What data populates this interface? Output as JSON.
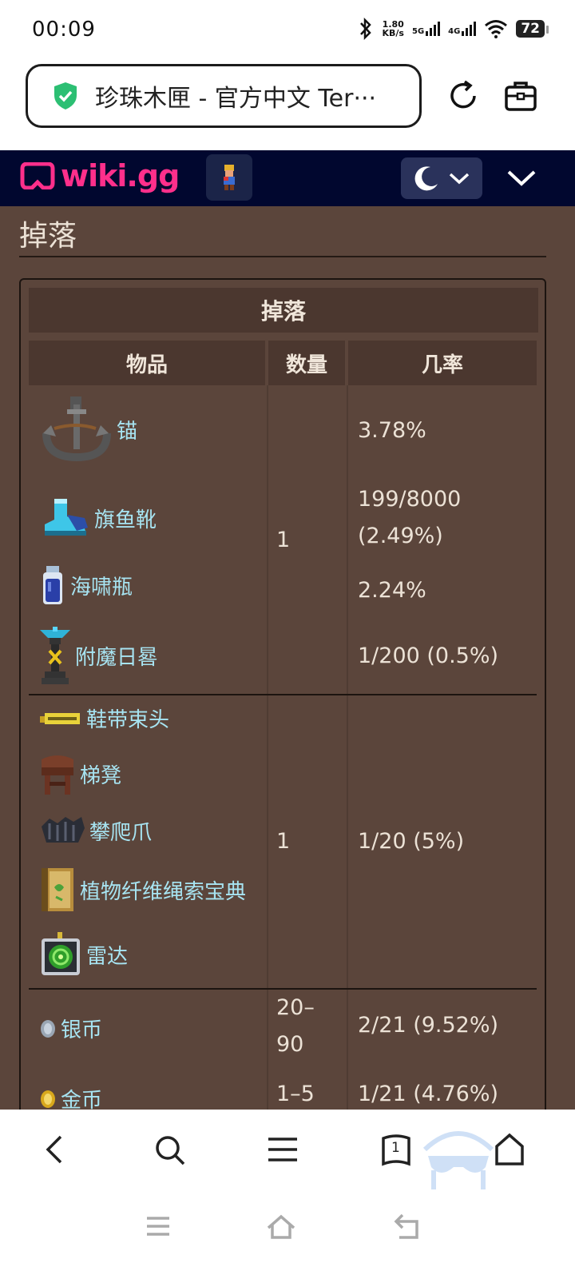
{
  "status_bar": {
    "time": "00:09",
    "speed_value": "1.80",
    "speed_unit": "KB/s",
    "net1": "5G",
    "net2": "4G",
    "battery": "72"
  },
  "browser": {
    "url_title": "珍珠木匣 - 官方中文 Ter···"
  },
  "wiki_header": {
    "logo_text": "wiki.gg",
    "brand_color": "#ff2f8b"
  },
  "section": {
    "title": "掉落"
  },
  "drops_table": {
    "caption": "掉落",
    "headers": [
      "物品",
      "数量",
      "几率"
    ],
    "groups": [
      {
        "items": [
          {
            "name": "锚",
            "icon": "anchor-icon"
          },
          {
            "name": "旗鱼靴",
            "icon": "sailfish-boots-icon"
          },
          {
            "name": "海啸瓶",
            "icon": "tsunami-bottle-icon"
          },
          {
            "name": "附魔日晷",
            "icon": "enchanted-sundial-icon"
          }
        ],
        "quantity": "1",
        "rates": [
          "3.78%",
          "199/8000",
          "(2.49%)",
          "2.24%",
          "1/200 (0.5%)"
        ]
      },
      {
        "items": [
          {
            "name": "鞋带束头",
            "icon": "shoelace-aglet-icon"
          },
          {
            "name": "梯凳",
            "icon": "step-stool-icon"
          },
          {
            "name": "攀爬爪",
            "icon": "climbing-claws-icon"
          },
          {
            "name": "植物纤维绳索宝典",
            "icon": "fiber-rope-tome-icon"
          },
          {
            "name": "雷达",
            "icon": "radar-icon"
          }
        ],
        "quantity": "1",
        "rate": "1/20 (5%)"
      },
      {
        "items": [
          {
            "name": "银币",
            "icon": "silver-coin-icon",
            "quantity_line1": "20–",
            "quantity_line2": "90",
            "rate": "2/21 (9.52%)"
          },
          {
            "name": "金币",
            "icon": "gold-coin-icon",
            "quantity": "1–5",
            "rate": "1/21 (4.76%)"
          }
        ]
      }
    ]
  },
  "bottom_nav": {
    "tab_count": "1"
  }
}
